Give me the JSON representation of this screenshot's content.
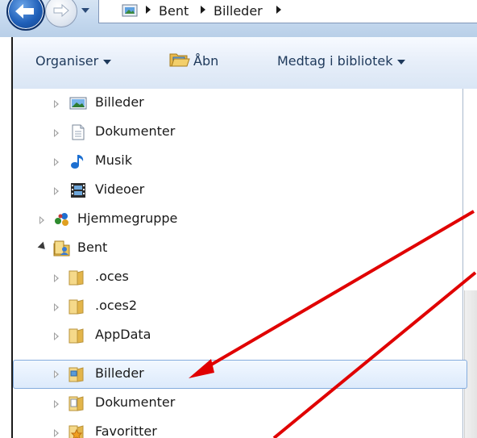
{
  "address_bar": {
    "breadcrumbs": [
      "Bent",
      "Billeder"
    ]
  },
  "toolbar": {
    "organise_label": "Organiser",
    "open_label": "Åbn",
    "include_label": "Medtag i bibliotek"
  },
  "nav_tree": {
    "items": [
      {
        "label": "Billeder",
        "icon": "pictures-library-icon"
      },
      {
        "label": "Dokumenter",
        "icon": "documents-library-icon"
      },
      {
        "label": "Musik",
        "icon": "music-note-icon"
      },
      {
        "label": "Videoer",
        "icon": "film-strip-icon"
      },
      {
        "label": "Hjemmegruppe",
        "icon": "homegroup-icon"
      },
      {
        "label": "Bent",
        "icon": "user-folder-icon"
      },
      {
        "label": ".oces",
        "icon": "folder-icon"
      },
      {
        "label": ".oces2",
        "icon": "folder-icon"
      },
      {
        "label": "AppData",
        "icon": "folder-icon"
      },
      {
        "label": "Billeder",
        "icon": "pictures-folder-icon"
      },
      {
        "label": "Dokumenter",
        "icon": "documents-folder-icon"
      },
      {
        "label": "Favoritter",
        "icon": "favorites-folder-icon"
      }
    ]
  },
  "colors": {
    "selection_border": "#84acdd",
    "annotation_red": "#e00000",
    "toolbar_text": "#1e395b"
  }
}
